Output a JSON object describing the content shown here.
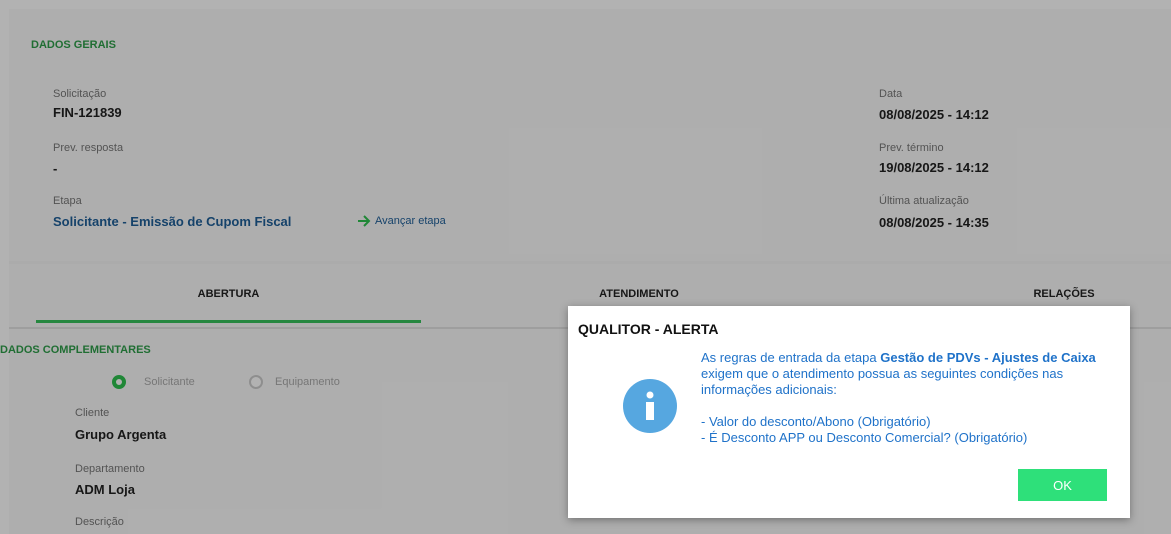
{
  "dados_gerais": {
    "title": "DADOS GERAIS",
    "solicitacao_label": "Solicitação",
    "solicitacao_value": "FIN-121839",
    "prev_resposta_label": "Prev. resposta",
    "prev_resposta_value": "-",
    "etapa_label": "Etapa",
    "etapa_value": "Solicitante - Emissão de Cupom Fiscal",
    "avancar_label": "Avançar etapa",
    "data_label": "Data",
    "data_value": "08/08/2025 - 14:12",
    "prev_termino_label": "Prev. término",
    "prev_termino_value": "19/08/2025 - 14:12",
    "ultima_label": "Última atualização",
    "ultima_value": "08/08/2025 - 14:35"
  },
  "tabs": [
    {
      "label": "ABERTURA",
      "active": true
    },
    {
      "label": "ATENDIMENTO",
      "active": false
    },
    {
      "label": "RELAÇÕES",
      "active": false
    }
  ],
  "dados_complementares": {
    "title": "DADOS COMPLEMENTARES",
    "radio_solicitante": "Solicitante",
    "radio_equipamento": "Equipamento",
    "cliente_label": "Cliente",
    "cliente_value": "Grupo Argenta",
    "departamento_label": "Departamento",
    "departamento_value": "ADM Loja",
    "descricao_label": "Descrição"
  },
  "dialog": {
    "title": "QUALITOR - ALERTA",
    "text_part1": "As regras de entrada da etapa ",
    "text_bold": "Gestão de PDVs - Ajustes de Caixa",
    "text_part2": " exigem que o atendimento possua as seguintes condições nas informações adicionais:",
    "condition_1": "- Valor do desconto/Abono (Obrigatório)",
    "condition_2": "- É Desconto APP ou Desconto Comercial? (Obrigatório)",
    "ok_label": "OK",
    "icon": "info-icon"
  },
  "colors": {
    "accent_green": "#37c25c",
    "link_blue": "#1f5f99",
    "ok_green": "#2ee07a",
    "info_blue": "#56a7e0"
  }
}
